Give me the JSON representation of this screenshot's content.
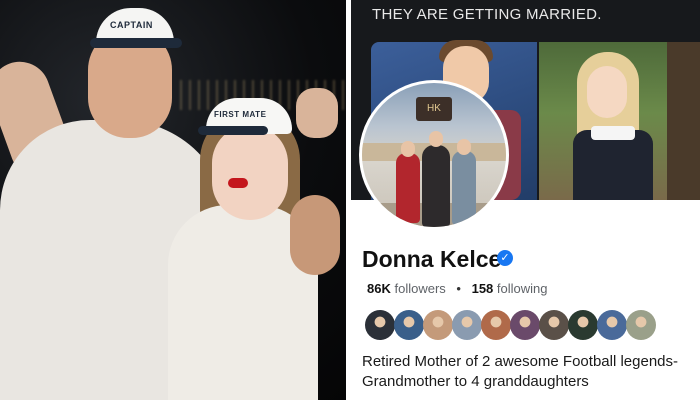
{
  "photo": {
    "cap_left_text": "CAPTAIN",
    "cap_right_text": "FIRST MATE"
  },
  "post_header": {
    "caption": "THEY ARE GETTING MARRIED."
  },
  "profile": {
    "name": "Donna Kelce",
    "verified": true,
    "followers_count": "86K",
    "followers_label": "followers",
    "following_count": "158",
    "following_label": "following",
    "avatar_sign": "HK",
    "bio_line1": "Retired Mother of 2 awesome Football legends-",
    "bio_line2": "Grandmother to 4 granddaughters"
  },
  "friend_avatars": [
    {
      "name": "friend-avatar-1",
      "color": "#2b3038"
    },
    {
      "name": "friend-avatar-2",
      "color": "#3a5f8a"
    },
    {
      "name": "friend-avatar-3",
      "color": "#c49a7a"
    },
    {
      "name": "friend-avatar-4",
      "color": "#8a9bb0"
    },
    {
      "name": "friend-avatar-5",
      "color": "#b06a4a"
    },
    {
      "name": "friend-avatar-6",
      "color": "#6a4a6a"
    },
    {
      "name": "friend-avatar-7",
      "color": "#5a5048"
    },
    {
      "name": "friend-avatar-8",
      "color": "#2a3a30"
    },
    {
      "name": "friend-avatar-9",
      "color": "#4a6a9a"
    },
    {
      "name": "friend-avatar-10",
      "color": "#9aa08a"
    }
  ],
  "colors": {
    "verified_blue": "#1877f2",
    "header_dark": "#17191c"
  }
}
